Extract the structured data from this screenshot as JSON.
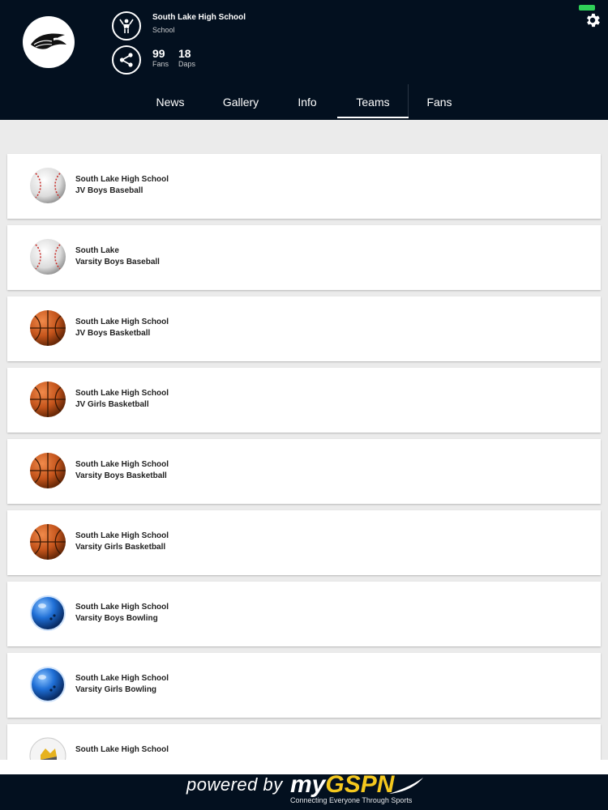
{
  "header": {
    "school_name": "South Lake High School",
    "school_type": "School",
    "fans_count": "99",
    "fans_label": "Fans",
    "daps_count": "18",
    "daps_label": "Daps"
  },
  "tabs": [
    {
      "label": "News"
    },
    {
      "label": "Gallery"
    },
    {
      "label": "Info"
    },
    {
      "label": "Teams"
    },
    {
      "label": "Fans"
    }
  ],
  "active_tab": "Teams",
  "teams": [
    {
      "line1": "South Lake High School",
      "line2": "JV Boys Baseball",
      "icon": "baseball-icon"
    },
    {
      "line1": "South Lake",
      "line2": "Varsity Boys Baseball",
      "icon": "baseball-icon"
    },
    {
      "line1": "South Lake High School",
      "line2": "JV Boys Basketball",
      "icon": "basketball-icon"
    },
    {
      "line1": "South Lake High School",
      "line2": "JV Girls Basketball",
      "icon": "basketball-icon"
    },
    {
      "line1": "South Lake High School",
      "line2": "Varsity Boys Basketball",
      "icon": "basketball-icon"
    },
    {
      "line1": "South Lake High School",
      "line2": "Varsity Girls Basketball",
      "icon": "basketball-icon"
    },
    {
      "line1": "South Lake High School",
      "line2": "Varsity Boys Bowling",
      "icon": "bowling-ball-icon"
    },
    {
      "line1": "South Lake High School",
      "line2": "Varsity Girls Bowling",
      "icon": "bowling-ball-icon"
    },
    {
      "line1": "South Lake High School",
      "line2": "",
      "icon": "cheer-icon"
    }
  ],
  "footer": {
    "powered_by": "powered by",
    "brand_my": "my",
    "brand_gspn": "GSPN",
    "tagline": "Connecting Everyone Through Sports"
  },
  "colors": {
    "header_bg": "#03101f",
    "brand_yellow": "#f4c81e",
    "battery_green": "#2fd158",
    "basketball_orange": "#c5551c",
    "bowling_blue": "#1f6fd6"
  }
}
